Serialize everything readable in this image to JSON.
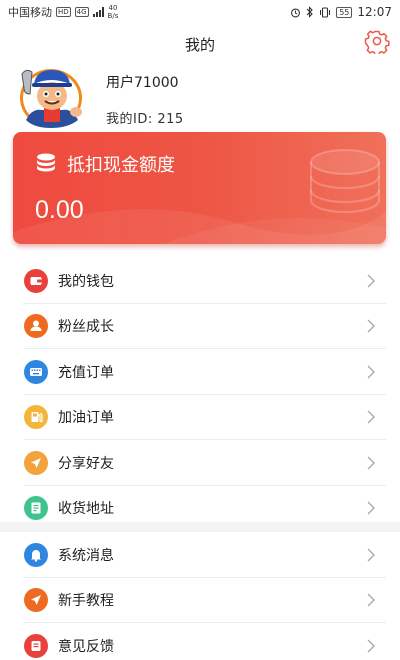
{
  "status_bar": {
    "carrier": "中国移动",
    "hd_tag": "HD",
    "net_tag": "4G",
    "speed_value": "40",
    "speed_unit": "B/s",
    "battery": "55",
    "time": "12:07"
  },
  "header": {
    "title": "我的",
    "settings_icon": "gear-icon"
  },
  "profile": {
    "username": "用户71000",
    "user_id": "我的ID: 215"
  },
  "card": {
    "title": "抵扣现金额度",
    "amount": "0.00",
    "icon": "coin-stack-icon"
  },
  "menu_primary": [
    {
      "label": "我的钱包",
      "icon": "wallet-icon",
      "color": "#e8413b"
    },
    {
      "label": "粉丝成长",
      "icon": "user-icon",
      "color": "#ee6a20"
    },
    {
      "label": "充值订单",
      "icon": "keyboard-icon",
      "color": "#2f86e0"
    },
    {
      "label": "加油订单",
      "icon": "fuel-icon",
      "color": "#f2b63a"
    },
    {
      "label": "分享好友",
      "icon": "send-icon",
      "color": "#f3a33b"
    },
    {
      "label": "收货地址",
      "icon": "address-book-icon",
      "color": "#3fc38d"
    }
  ],
  "menu_secondary": [
    {
      "label": "系统消息",
      "icon": "bell-icon",
      "color": "#2f86e0"
    },
    {
      "label": "新手教程",
      "icon": "send-icon",
      "color": "#ee6a20"
    },
    {
      "label": "意见反馈",
      "icon": "feedback-icon",
      "color": "#e8413b"
    }
  ]
}
